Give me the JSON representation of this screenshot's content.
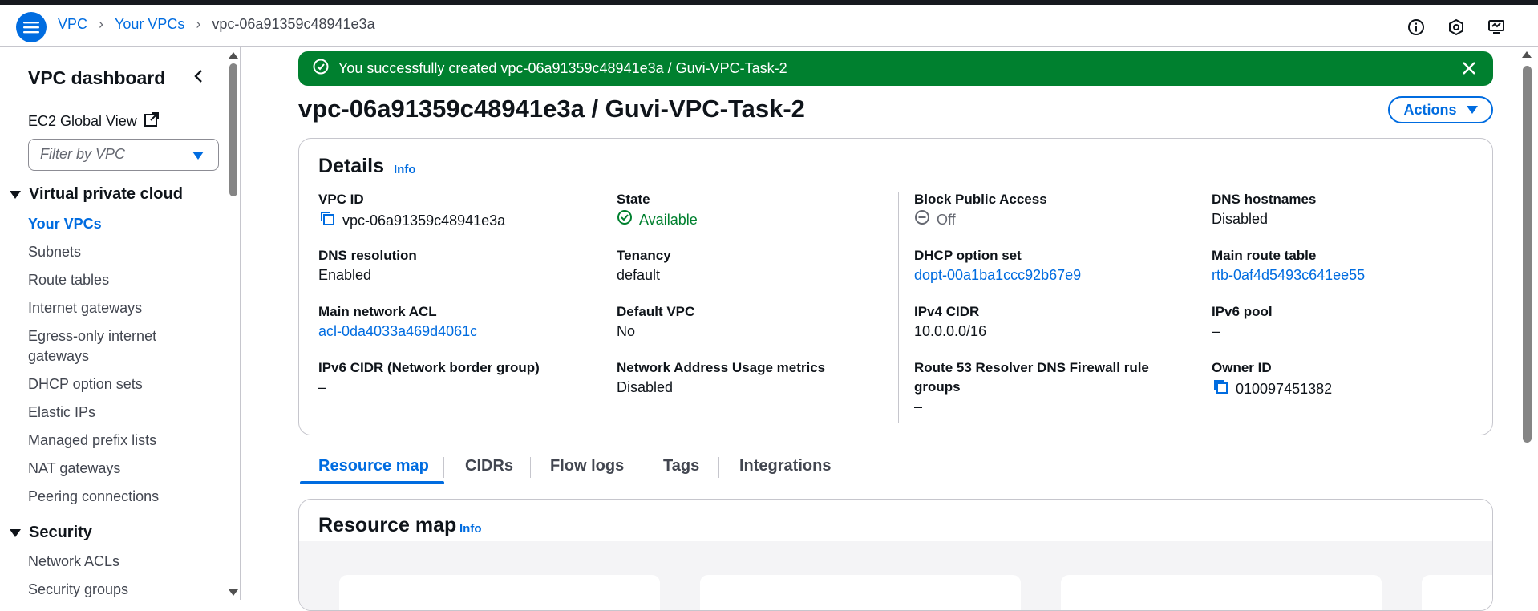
{
  "breadcrumb": {
    "root": "VPC",
    "parent": "Your VPCs",
    "current": "vpc-06a91359c48941e3a"
  },
  "sidebar": {
    "title": "VPC dashboard",
    "ec2_link": "EC2 Global View",
    "filter_placeholder": "Filter by VPC",
    "sections": [
      {
        "title": "Virtual private cloud",
        "items": [
          "Your VPCs",
          "Subnets",
          "Route tables",
          "Internet gateways",
          "Egress-only internet gateways",
          "DHCP option sets",
          "Elastic IPs",
          "Managed prefix lists",
          "NAT gateways",
          "Peering connections"
        ]
      },
      {
        "title": "Security",
        "items": [
          "Network ACLs",
          "Security groups"
        ]
      }
    ],
    "active_item": "Your VPCs"
  },
  "flash": {
    "message": "You successfully created vpc-06a91359c48941e3a / Guvi-VPC-Task-2"
  },
  "page": {
    "title": "vpc-06a91359c48941e3a / Guvi-VPC-Task-2",
    "actions_label": "Actions"
  },
  "details": {
    "title": "Details",
    "info": "Info",
    "fields": {
      "vpc_id": {
        "label": "VPC ID",
        "value": "vpc-06a91359c48941e3a"
      },
      "state": {
        "label": "State",
        "value": "Available"
      },
      "block_public_access": {
        "label": "Block Public Access",
        "value": "Off"
      },
      "dns_hostnames": {
        "label": "DNS hostnames",
        "value": "Disabled"
      },
      "dns_resolution": {
        "label": "DNS resolution",
        "value": "Enabled"
      },
      "tenancy": {
        "label": "Tenancy",
        "value": "default"
      },
      "dhcp_option_set": {
        "label": "DHCP option set",
        "value": "dopt-00a1ba1ccc92b67e9"
      },
      "main_route_table": {
        "label": "Main route table",
        "value": "rtb-0af4d5493c641ee55"
      },
      "main_network_acl": {
        "label": "Main network ACL",
        "value": "acl-0da4033a469d4061c"
      },
      "default_vpc": {
        "label": "Default VPC",
        "value": "No"
      },
      "ipv4_cidr": {
        "label": "IPv4 CIDR",
        "value": "10.0.0.0/16"
      },
      "ipv6_pool": {
        "label": "IPv6 pool",
        "value": "–"
      },
      "ipv6_cidr": {
        "label": "IPv6 CIDR (Network border group)",
        "value": "–"
      },
      "nau_metrics": {
        "label": "Network Address Usage metrics",
        "value": "Disabled"
      },
      "route53_firewall": {
        "label": "Route 53 Resolver DNS Firewall rule groups",
        "value": "–"
      },
      "owner_id": {
        "label": "Owner ID",
        "value": "010097451382"
      }
    }
  },
  "tabs": [
    "Resource map",
    "CIDRs",
    "Flow logs",
    "Tags",
    "Integrations"
  ],
  "active_tab": "Resource map",
  "resource_map": {
    "title": "Resource map",
    "info": "Info"
  },
  "colors": {
    "accent": "#006ce0",
    "success": "#00802f",
    "text": "#0f141a"
  }
}
